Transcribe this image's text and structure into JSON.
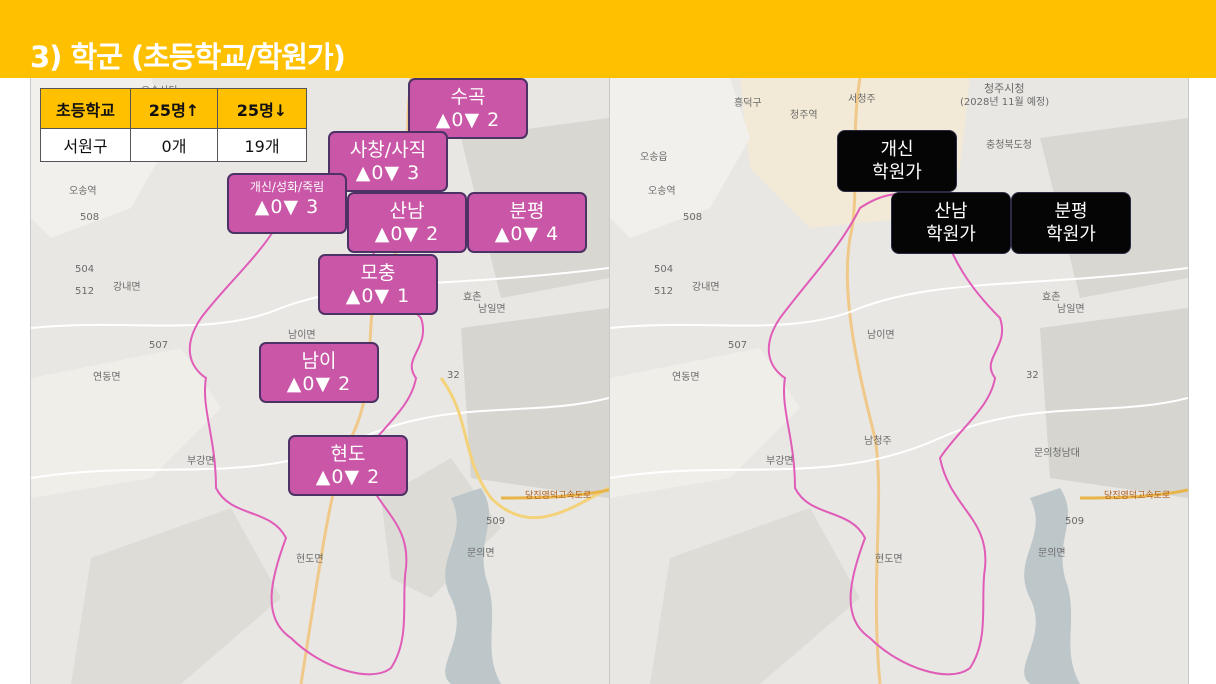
{
  "header": {
    "title": "3) 학군 (초등학교/학원가)"
  },
  "table": {
    "headers": [
      "초등학교",
      "25명↑",
      "25명↓"
    ],
    "rows": [
      [
        "서원구",
        "0개",
        "19개"
      ]
    ]
  },
  "regions": [
    {
      "name": "수곡",
      "counts": "▲0▼ 2"
    },
    {
      "name": "사창/사직",
      "counts": "▲0▼ 3"
    },
    {
      "name": "개신/성화/죽림",
      "counts": "▲0▼ 3"
    },
    {
      "name": "산남",
      "counts": "▲0▼ 2"
    },
    {
      "name": "분평",
      "counts": "▲0▼ 4"
    },
    {
      "name": "모충",
      "counts": "▲0▼ 1"
    },
    {
      "name": "남이",
      "counts": "▲0▼ 2"
    },
    {
      "name": "현도",
      "counts": "▲0▼ 2"
    }
  ],
  "academies": [
    {
      "line1": "개신",
      "line2": "학원가"
    },
    {
      "line1": "산남",
      "line2": "학원가"
    },
    {
      "line1": "분평",
      "line2": "학원가"
    }
  ],
  "map_left_labels": [
    "오송역",
    "강내면",
    "연동면",
    "부강면",
    "남이면",
    "현도면",
    "효촌",
    "남일면",
    "문의면",
    "오송산단",
    "508",
    "504",
    "512",
    "507",
    "32",
    "509",
    "당진영덕고속도로"
  ],
  "map_right_labels": [
    "청주시청",
    "(2028년 11월 예정)",
    "충청북도청",
    "흥덕구",
    "청주역",
    "서청주",
    "오송읍",
    "오송역",
    "강내면",
    "연동면",
    "부강면",
    "남이면",
    "현도면",
    "효촌",
    "남일면",
    "문의청남대",
    "문의면",
    "남청주",
    "508",
    "504",
    "512",
    "507",
    "32",
    "509",
    "당진영덕고속도로"
  ],
  "colors": {
    "header": "#ffc000",
    "region_box": "#c956a6",
    "academy_box": "#050505",
    "boundary": "#e05cb8"
  }
}
